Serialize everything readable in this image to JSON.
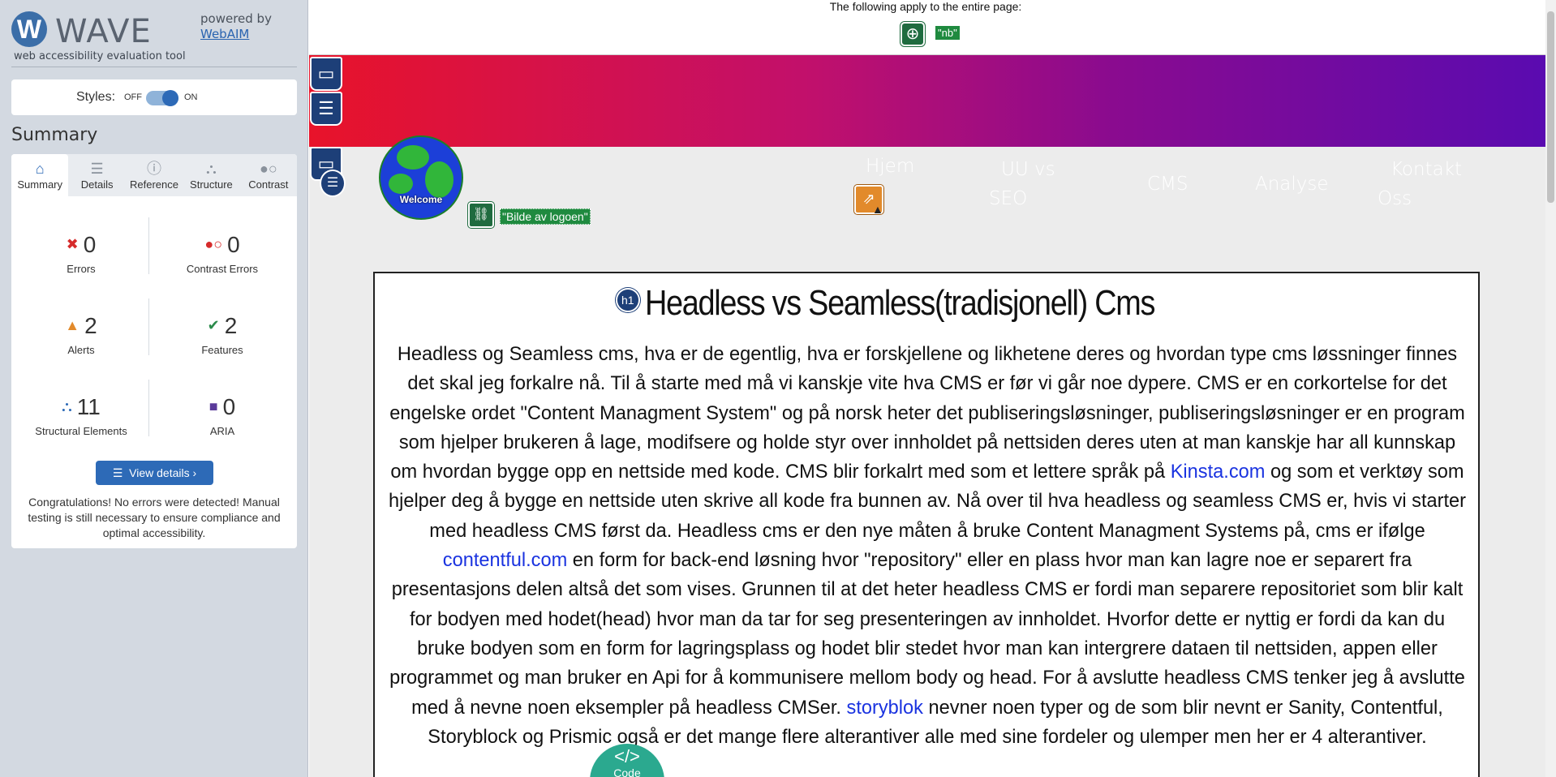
{
  "wave": {
    "logo_letter": "W",
    "title": "WAVE",
    "tagline": "web accessibility evaluation tool",
    "powered_by": "powered by",
    "webaim": "WebAIM",
    "styles_label": "Styles:",
    "styles_off": "OFF",
    "styles_on": "ON",
    "summary_heading": "Summary",
    "tabs": [
      {
        "label": "Summary",
        "icon": "home-icon",
        "active": true
      },
      {
        "label": "Details",
        "icon": "list-icon",
        "active": false
      },
      {
        "label": "Reference",
        "icon": "info-icon",
        "active": false
      },
      {
        "label": "Structure",
        "icon": "hierarchy-icon",
        "active": false
      },
      {
        "label": "Contrast",
        "icon": "contrast-icon",
        "active": false
      }
    ],
    "stats": {
      "errors": {
        "count": "0",
        "label": "Errors",
        "color": "#d62b2b"
      },
      "contrast_errors": {
        "count": "0",
        "label": "Contrast Errors",
        "color": "#d62b2b"
      },
      "alerts": {
        "count": "2",
        "label": "Alerts",
        "color": "#e28a2b"
      },
      "features": {
        "count": "2",
        "label": "Features",
        "color": "#2a8a4a"
      },
      "structural": {
        "count": "11",
        "label": "Structural Elements",
        "color": "#2d6ab7"
      },
      "aria": {
        "count": "0",
        "label": "ARIA",
        "color": "#5a3a9a"
      }
    },
    "view_details": "View details ›",
    "congrats": "Congratulations! No errors were detected! Manual testing is still necessary to ensure compliance and optimal accessibility."
  },
  "page": {
    "notice": "The following apply to the entire page:",
    "lang_label": "\"nb\"",
    "logo_word": "Welcome",
    "logo_alt": "\"Bilde av logoen\"",
    "nav": {
      "hjem": "Hjem",
      "uu_vs": "UU vs",
      "seo": "SEO",
      "cms": "CMS",
      "analyse": "Analyse",
      "kontakt": "Kontakt",
      "oss": "Oss"
    },
    "h1_badge": "h1",
    "heading": "Headless vs Seamless(tradisjonell) Cms",
    "paragraph": {
      "p1": "Headless og Seamless cms, hva er de egentlig, hva er forskjellene og likhetene deres og hvordan type cms løssninger finnes det skal jeg forkalre nå. Til å starte med må vi kanskje vite hva CMS er før vi går noe dypere. CMS er en corkortelse for det engelske ordet \"Content Managment System\" og på norsk heter det publiseringsløsninger, publiseringsløsninger er en program som hjelper brukeren å lage, modifsere og holde styr over innholdet på nettsiden deres uten at man kanskje har all kunnskap om hvordan bygge opp en nettside med kode. CMS blir forkalrt med som et lettere språk på ",
      "link1": "Kinsta.com",
      "p2": " og som et verktøy som hjelper deg å bygge en nettside uten skrive all kode fra bunnen av. Nå over til hva headless og seamless CMS er, hvis vi starter med headless CMS først da. Headless cms er den nye måten å bruke Content Managment Systems på, cms er ifølge ",
      "link2": "contentful.com",
      "p3": " en form for back-end løsning hvor \"repository\" eller en plass hvor man kan lagre noe er separert fra presentasjons delen altså det som vises. Grunnen til at det heter headless CMS er fordi man separere repositoriet som blir kalt for bodyen med hodet(head) hvor man da tar for seg presenteringen av innholdet. Hvorfor dette er nyttig er fordi da kan du bruke bodyen som en form for lagringsplass og hodet blir stedet hvor man kan intergrere dataen til nettsiden, appen eller programmet og man bruker en Api for å kommunisere mellom body og head. For å avslutte headless CMS tenker jeg å avslutte med å nevne noen eksempler på headless CMSer. ",
      "link3": "storyblok",
      "p4": " nevner noen typer og de som blir nevnt er Sanity, Contentful, Storyblock og Prismic også er det mange flere alterantiver alle med sine fordeler og ulemper men her er 4 alterantiver."
    },
    "code_glyph": "</>",
    "code_label": "Code",
    "banner_colors": [
      "#e8132a",
      "#5a0bb0"
    ]
  }
}
